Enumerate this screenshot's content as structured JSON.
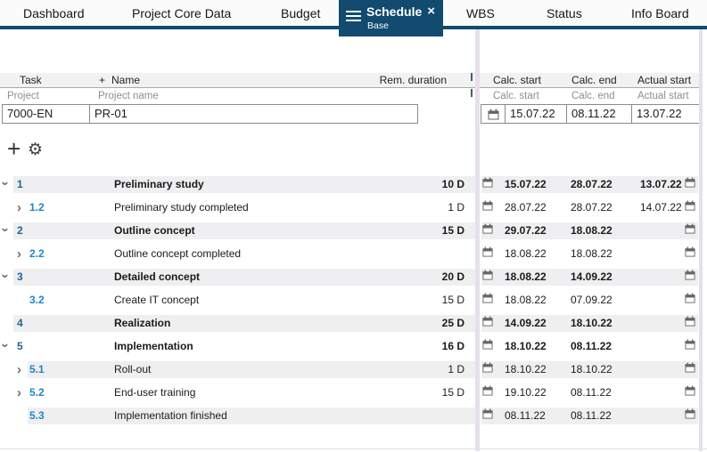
{
  "tabs": [
    {
      "label": "Dashboard"
    },
    {
      "label": "Project Core Data"
    },
    {
      "label": "Budget"
    },
    {
      "label": "Schedule",
      "sublabel": "Base",
      "active": true
    },
    {
      "label": "WBS"
    },
    {
      "label": "Status"
    },
    {
      "label": "Info Board"
    }
  ],
  "icons": {
    "glyphs": {
      "plus": "+",
      "gear": "⚙",
      "close": "×",
      "chevron": "›"
    },
    "names": [
      "hamburger-icon",
      "close-icon",
      "plus-icon",
      "gear-icon",
      "calendar-icon",
      "chevron-down-icon",
      "chevron-right-icon"
    ]
  },
  "grid": {
    "header": {
      "task": "Task",
      "plus": "+",
      "name": "Name",
      "rem_duration": "Rem. duration",
      "calc_start": "Calc. start",
      "calc_end": "Calc. end",
      "actual_start": "Actual start"
    },
    "subheader": {
      "task": "Project",
      "name": "Project name",
      "calc_start": "Calc. start",
      "calc_end": "Calc. end",
      "actual_start": "Actual start"
    },
    "project_row": {
      "task": "7000-EN",
      "name": "PR-01",
      "calc_start": "15.07.22",
      "calc_end": "08.11.22",
      "actual_start": "13.07.22"
    }
  },
  "rows": [
    {
      "num": "1",
      "chevron": "down",
      "level": 1,
      "bold": true,
      "name": "Preliminary study",
      "duration": "10 D",
      "calc_start": "15.07.22",
      "calc_end": "28.07.22",
      "actual_start": "13.07.22"
    },
    {
      "num": "1.2",
      "chevron": "right",
      "level": 2,
      "bold": false,
      "name": "Preliminary study completed",
      "duration": "1 D",
      "calc_start": "28.07.22",
      "calc_end": "28.07.22",
      "actual_start": "14.07.22"
    },
    {
      "num": "2",
      "chevron": "down",
      "level": 1,
      "bold": true,
      "name": "Outline concept",
      "duration": "15 D",
      "calc_start": "29.07.22",
      "calc_end": "18.08.22",
      "actual_start": ""
    },
    {
      "num": "2.2",
      "chevron": "right",
      "level": 2,
      "bold": false,
      "name": "Outline concept completed",
      "duration": "",
      "calc_start": "18.08.22",
      "calc_end": "18.08.22",
      "actual_start": ""
    },
    {
      "num": "3",
      "chevron": "down",
      "level": 1,
      "bold": true,
      "name": "Detailed concept",
      "duration": "20 D",
      "calc_start": "18.08.22",
      "calc_end": "14.09.22",
      "actual_start": ""
    },
    {
      "num": "3.2",
      "chevron": "none",
      "level": 2,
      "bold": false,
      "name": "Create IT concept",
      "duration": "15 D",
      "calc_start": "18.08.22",
      "calc_end": "07.09.22",
      "actual_start": ""
    },
    {
      "num": "4",
      "chevron": "none",
      "level": 1,
      "bold": true,
      "name": "Realization",
      "duration": "25 D",
      "calc_start": "14.09.22",
      "calc_end": "18.10.22",
      "actual_start": ""
    },
    {
      "num": "5",
      "chevron": "down",
      "level": 1,
      "bold": true,
      "name": "Implementation",
      "duration": "16 D",
      "calc_start": "18.10.22",
      "calc_end": "08.11.22",
      "actual_start": ""
    },
    {
      "num": "5.1",
      "chevron": "right",
      "level": 2,
      "bold": false,
      "name": "Roll-out",
      "duration": "1 D",
      "calc_start": "18.10.22",
      "calc_end": "18.10.22",
      "actual_start": ""
    },
    {
      "num": "5.2",
      "chevron": "right",
      "level": 2,
      "bold": false,
      "name": "End-user training",
      "duration": "15 D",
      "calc_start": "19.10.22",
      "calc_end": "08.11.22",
      "actual_start": ""
    },
    {
      "num": "5.3",
      "chevron": "none",
      "level": 2,
      "bold": false,
      "name": "Implementation finished",
      "duration": "",
      "calc_start": "08.11.22",
      "calc_end": "08.11.22",
      "actual_start": ""
    }
  ],
  "colors": {
    "accent_navy": "#124a70",
    "row_stripe": "#efeff1",
    "splitter_lavender": "#e6e0ea",
    "parent_number_blue": "#25638c",
    "child_number_blue": "#1e87c6",
    "header_bg": "#f2f2f3"
  }
}
